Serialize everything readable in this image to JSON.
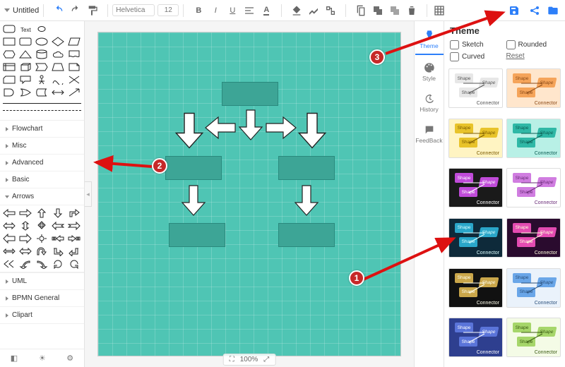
{
  "doc_title": "Untitled",
  "toolbar": {
    "font_family": "Helvetica",
    "font_size": "12",
    "zoom": "100%"
  },
  "left_panel": {
    "categories": [
      "Flowchart",
      "Misc",
      "Advanced",
      "Basic",
      "Arrows",
      "UML",
      "BPMN General",
      "Clipart"
    ]
  },
  "panel_nav": {
    "theme": "Theme",
    "style": "Style",
    "history": "History",
    "feedback": "FeedBack"
  },
  "theme_panel": {
    "title": "Theme",
    "opt_sketch": "Sketch",
    "opt_rounded": "Rounded",
    "opt_curved": "Curved",
    "reset": "Reset",
    "connector_label": "Connector",
    "shape_label": "Shape",
    "thumbs": [
      {
        "bg": "#ffffff",
        "accent": "#e7e7e7",
        "text": "#555"
      },
      {
        "bg": "#ffe6cc",
        "accent": "#f5a45a",
        "text": "#8a4a17"
      },
      {
        "bg": "#fff4c2",
        "accent": "#e8c32a",
        "text": "#7a5a00"
      },
      {
        "bg": "#b8f0e6",
        "accent": "#2fb8a6",
        "text": "#0b5c52"
      },
      {
        "bg": "#1a1a1a",
        "accent": "#c04bd9",
        "text": "#ffffff"
      },
      {
        "bg": "#ffffff",
        "accent": "#d07de0",
        "text": "#6a2c78"
      },
      {
        "bg": "#0e2a3a",
        "accent": "#2aa6c9",
        "text": "#dff"
      },
      {
        "bg": "#2a0b2e",
        "accent": "#e34bb1",
        "text": "#ffd"
      },
      {
        "bg": "#111111",
        "accent": "#caa64a",
        "text": "#ffe"
      },
      {
        "bg": "#eaf2fb",
        "accent": "#6aa6e8",
        "text": "#2a4f7a"
      },
      {
        "bg": "#2e3f8f",
        "accent": "#5a74d9",
        "text": "#fff"
      },
      {
        "bg": "#f4fbe6",
        "accent": "#a6d66a",
        "text": "#3a5a12"
      }
    ]
  },
  "annotations": {
    "m1": "1",
    "m2": "2",
    "m3": "3"
  }
}
